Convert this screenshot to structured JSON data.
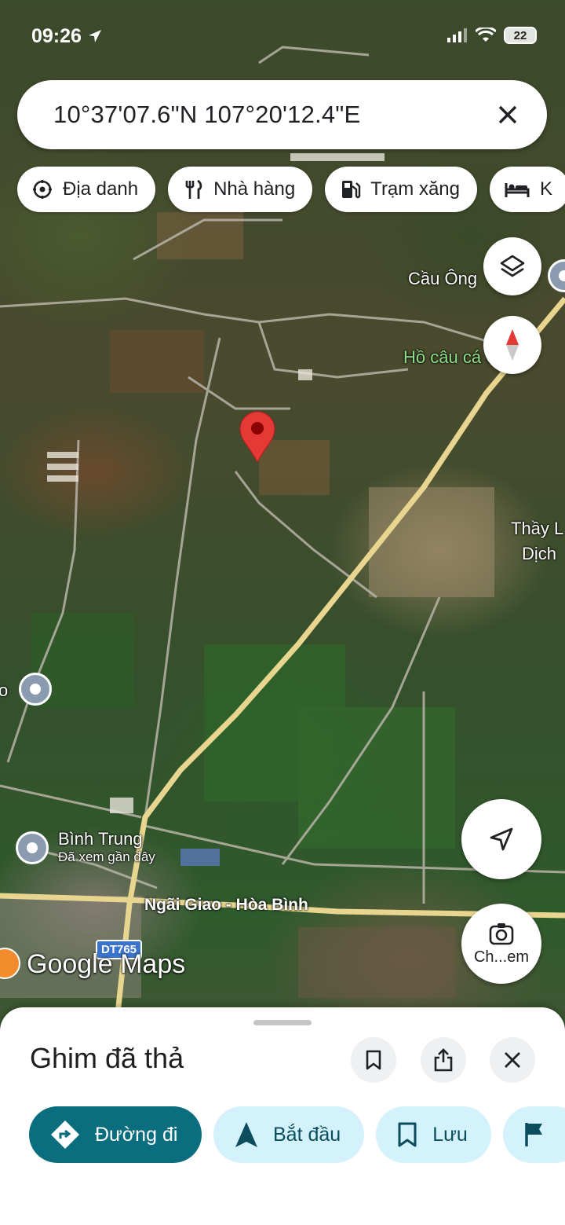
{
  "status_bar": {
    "time": "09:26",
    "battery": "22"
  },
  "search": {
    "coordinates": "10°37'07.6\"N 107°20'12.4\"E"
  },
  "chips": [
    {
      "label": "Địa danh",
      "icon": "landmark-icon"
    },
    {
      "label": "Nhà hàng",
      "icon": "restaurant-icon"
    },
    {
      "label": "Trạm xăng",
      "icon": "gas-station-icon"
    },
    {
      "label": "K",
      "icon": "hotel-icon"
    }
  ],
  "map": {
    "labels": {
      "cau_ong": "Cầu Ông",
      "ho_cau": "Hồ câu cá Uyển",
      "thay_l_1": "Thầy L",
      "thay_l_2": "Dịch",
      "left_o": "o",
      "binh_trung": "Bình Trung",
      "binh_trung_sub": "Đã xem gần đây",
      "road_name": "Ngãi Giao - Hòa Bình",
      "route_shield": "DT765"
    },
    "logo": "Google Maps"
  },
  "lens": {
    "label": "Ch...em"
  },
  "sheet": {
    "title": "Ghim đã thả",
    "actions": [
      {
        "label": "Đường đi",
        "icon": "directions-icon"
      },
      {
        "label": "Bắt đầu",
        "icon": "navigation-arrow-icon"
      },
      {
        "label": "Lưu",
        "icon": "bookmark-icon"
      },
      {
        "label": "",
        "icon": "flag-icon"
      }
    ]
  },
  "colors": {
    "primary": "#0b6e7e",
    "action_bg": "#d3f2fb",
    "pin": "#e53935"
  }
}
